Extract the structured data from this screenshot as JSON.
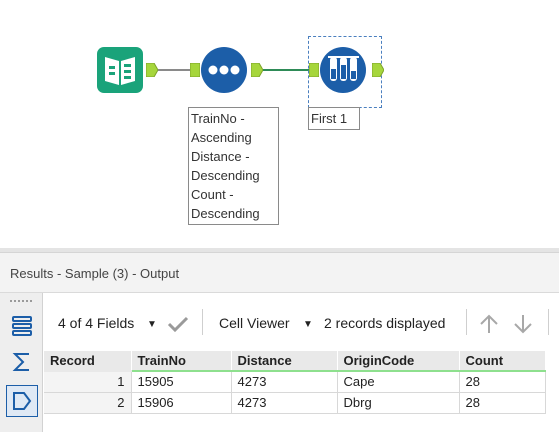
{
  "workflow": {
    "annotation_sample": "TrainNo -\nAscending\nDistance -\nDescending\nCount -\nDescending",
    "annotation_first": "First 1",
    "icons": {
      "input": "book-open-icon",
      "sort": "three-dots-icon",
      "sample": "test-tubes-icon"
    },
    "colors": {
      "input": "#1aa37a",
      "sort": "#1c5ea8",
      "sample": "#1c5ea8",
      "anchor": "#a6d63c",
      "wire": "#2e8b57"
    }
  },
  "results": {
    "title": "Results - Sample (3) - Output",
    "fields_label": "4 of 4 Fields",
    "viewer_label": "Cell Viewer",
    "records_label": "2 records displayed"
  },
  "table": {
    "columns": [
      "Record",
      "TrainNo",
      "Distance",
      "OriginCode",
      "Count"
    ],
    "rows": [
      [
        "1",
        "15905",
        "4273",
        "Cape",
        "28"
      ],
      [
        "2",
        "15906",
        "4273",
        "Dbrg",
        "28"
      ]
    ]
  }
}
